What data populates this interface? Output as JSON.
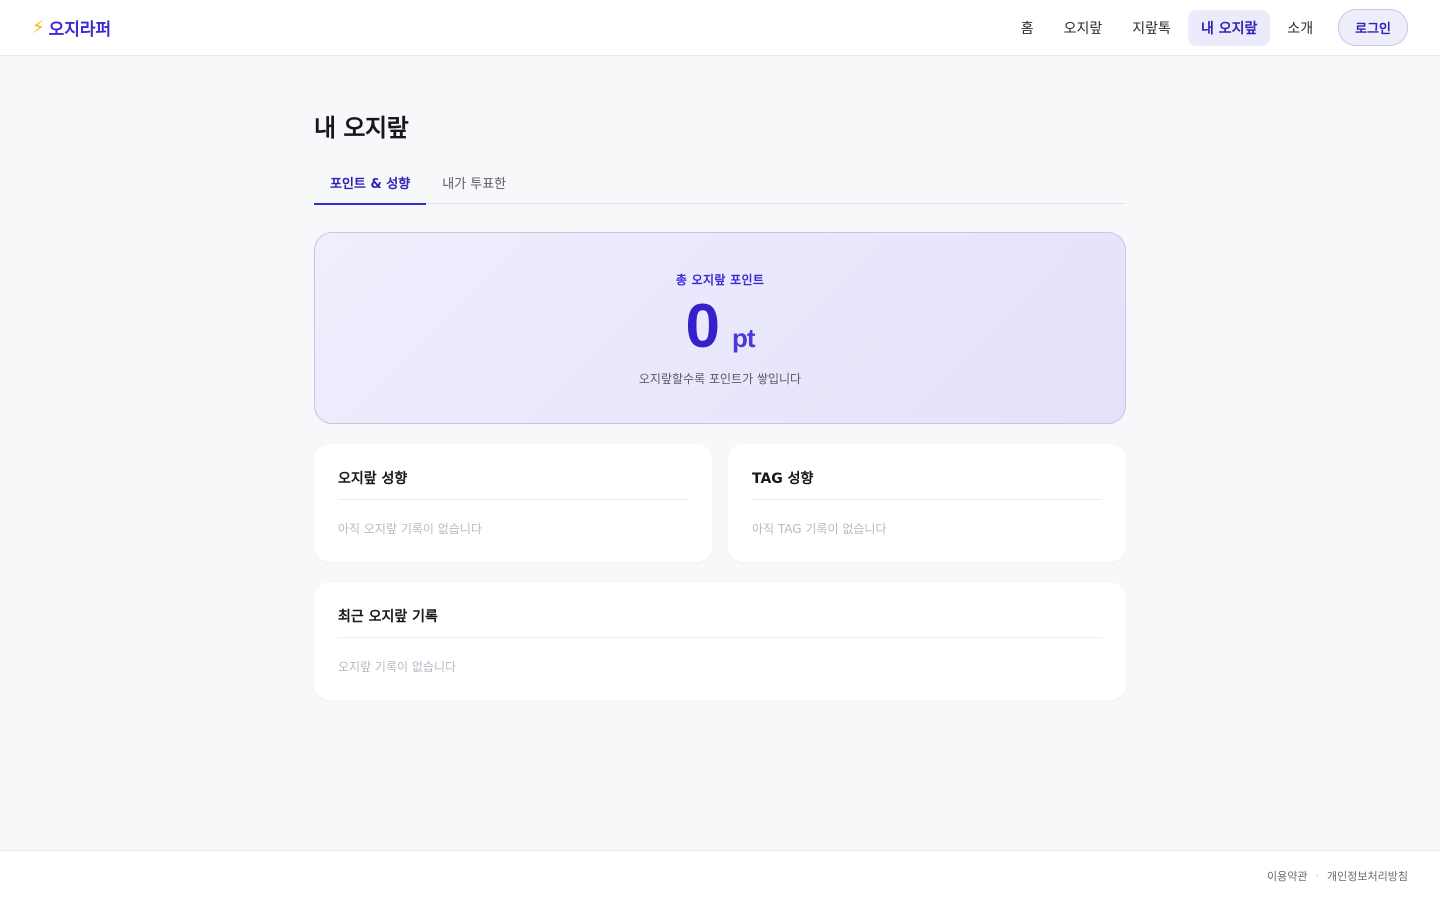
{
  "header": {
    "logo_text": "오지라퍼",
    "logo_icon": "lightning-icon",
    "nav": [
      {
        "label": "홈"
      },
      {
        "label": "오지랖"
      },
      {
        "label": "지랖톡"
      },
      {
        "label": "내 오지랖",
        "active": true
      },
      {
        "label": "소개"
      }
    ],
    "login_label": "로그인"
  },
  "main": {
    "title": "내 오지랖",
    "tabs": [
      {
        "label": "포인트 & 성향",
        "active": true
      },
      {
        "label": "내가 투표한"
      }
    ],
    "points": {
      "label": "총 오지랖 포인트",
      "value": "0",
      "unit": "pt",
      "caption": "오지랖할수록 포인트가 쌓입니다"
    },
    "tendency_card": {
      "title": "오지랖 성향",
      "empty": "아직 오지랖 기록이 없습니다"
    },
    "tag_card": {
      "title": "TAG 성향",
      "empty": "아직 TAG 기록이 없습니다"
    },
    "recent_card": {
      "title": "최근 오지랖 기록",
      "empty": "오지랖 기록이 없습니다"
    }
  },
  "footer": {
    "terms": "이용약관",
    "separator": "·",
    "privacy": "개인정보처리방침"
  },
  "colors": {
    "accent": "#3b2ad6",
    "accent_bg": "#ecebfc",
    "page_bg": "#f7f8fa"
  }
}
